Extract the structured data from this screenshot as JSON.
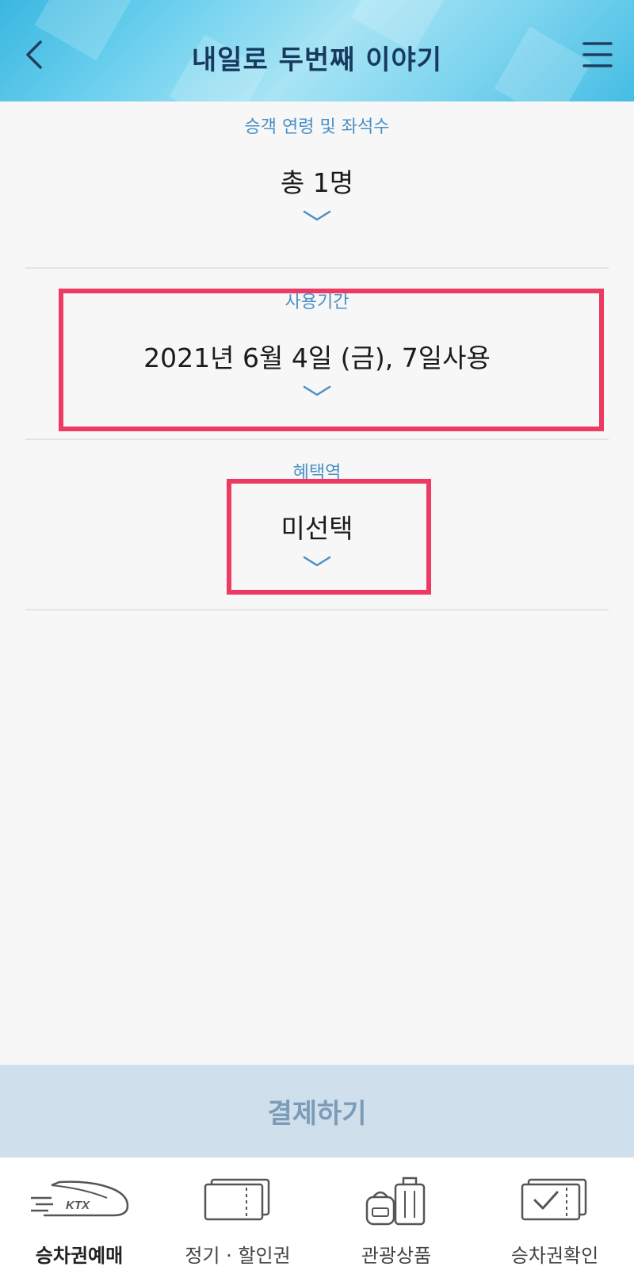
{
  "header": {
    "title": "내일로 두번째 이야기",
    "back_icon": "chevron-left-icon",
    "menu_icon": "hamburger-menu-icon"
  },
  "passengers": {
    "label": "승객 연령 및 좌석수",
    "value": "총 1명"
  },
  "period": {
    "label": "사용기간",
    "value": "2021년 6월 4일 (금), 7일사용"
  },
  "benefit_station": {
    "label": "혜택역",
    "value": "미선택"
  },
  "pay_button": {
    "label": "결제하기"
  },
  "tabbar": {
    "tabs": [
      {
        "label": "승차권예매",
        "icon": "ktx-train-icon",
        "active": true
      },
      {
        "label": "정기 · 할인권",
        "icon": "ticket-pass-icon",
        "active": false
      },
      {
        "label": "관광상품",
        "icon": "luggage-icon",
        "active": false
      },
      {
        "label": "승차권확인",
        "icon": "ticket-check-icon",
        "active": false
      }
    ]
  },
  "colors": {
    "accent_label": "#4a8fc4",
    "title": "#173a5e",
    "highlight": "#ec3a62",
    "pay_button_bg": "#cfdfeb"
  }
}
